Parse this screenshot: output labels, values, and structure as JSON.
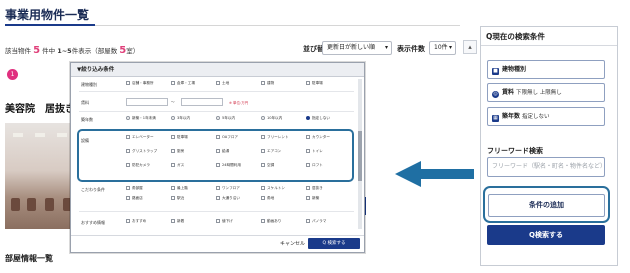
{
  "page": {
    "title": "事業用物件一覧",
    "count_prefix": "該当物件",
    "count_total": "5",
    "count_mid": "件中",
    "count_range": "1~5",
    "count_shown": "件表示（部屋数",
    "count_rooms": "5",
    "count_suffix": "室）",
    "sort_label": "並び替え",
    "sort_value": "更新日が新しい順",
    "per_page_label": "表示件数",
    "per_page_value": "10件",
    "badge": "1",
    "listing_title": "美容院　居抜き",
    "section_heading": "部屋情報一覧"
  },
  "modal": {
    "header": "▼絞り込み条件",
    "rows": {
      "r1": "建物種別",
      "r2": "賃料",
      "r3": "築年数",
      "r4": "設備",
      "r5": "こだわり条件",
      "r6": "おすすめ情報"
    },
    "r1_opts": [
      "店舗・事務所",
      "倉庫・工場",
      "土地",
      "建物",
      "駐車場"
    ],
    "r2_note": "※ 単位:万円",
    "r3_opts": [
      "新築・1年未満",
      "3年以内",
      "5年以内",
      "10年以内",
      "指定しない"
    ],
    "r4_opts": [
      "エレベーター",
      "駐車場",
      "OAフロア",
      "フリーレント",
      "カウンター",
      "グリストラップ",
      "厨房",
      "給湯",
      "エアコン",
      "トイレ",
      "防犯カメラ",
      "ガス",
      "24時間利用",
      "空調",
      "ロフト"
    ],
    "r5_opts": [
      "角部屋",
      "最上階",
      "ワンフロア",
      "スケルトン",
      "居抜き",
      "路面店",
      "駅近",
      "大通り沿い",
      "角地",
      "新築"
    ],
    "r6_opts": [
      "おすすめ",
      "新着",
      "値下げ",
      "動画あり",
      "パノラマ"
    ],
    "cancel": "キャンセル",
    "search": "Q 検索する"
  },
  "sidebar": {
    "title": "Q現在の検索条件",
    "building_label": "建物種別",
    "rent_label": "賃料",
    "rent_value": "下限無し 上限無し",
    "age_label": "築年数",
    "age_value": "指定しない",
    "keyword_label": "フリーワード検索",
    "keyword_placeholder": "フリーワード（駅名・町名・物件名など）",
    "add_condition": "条件の追加",
    "search_button": "Q検索する"
  }
}
